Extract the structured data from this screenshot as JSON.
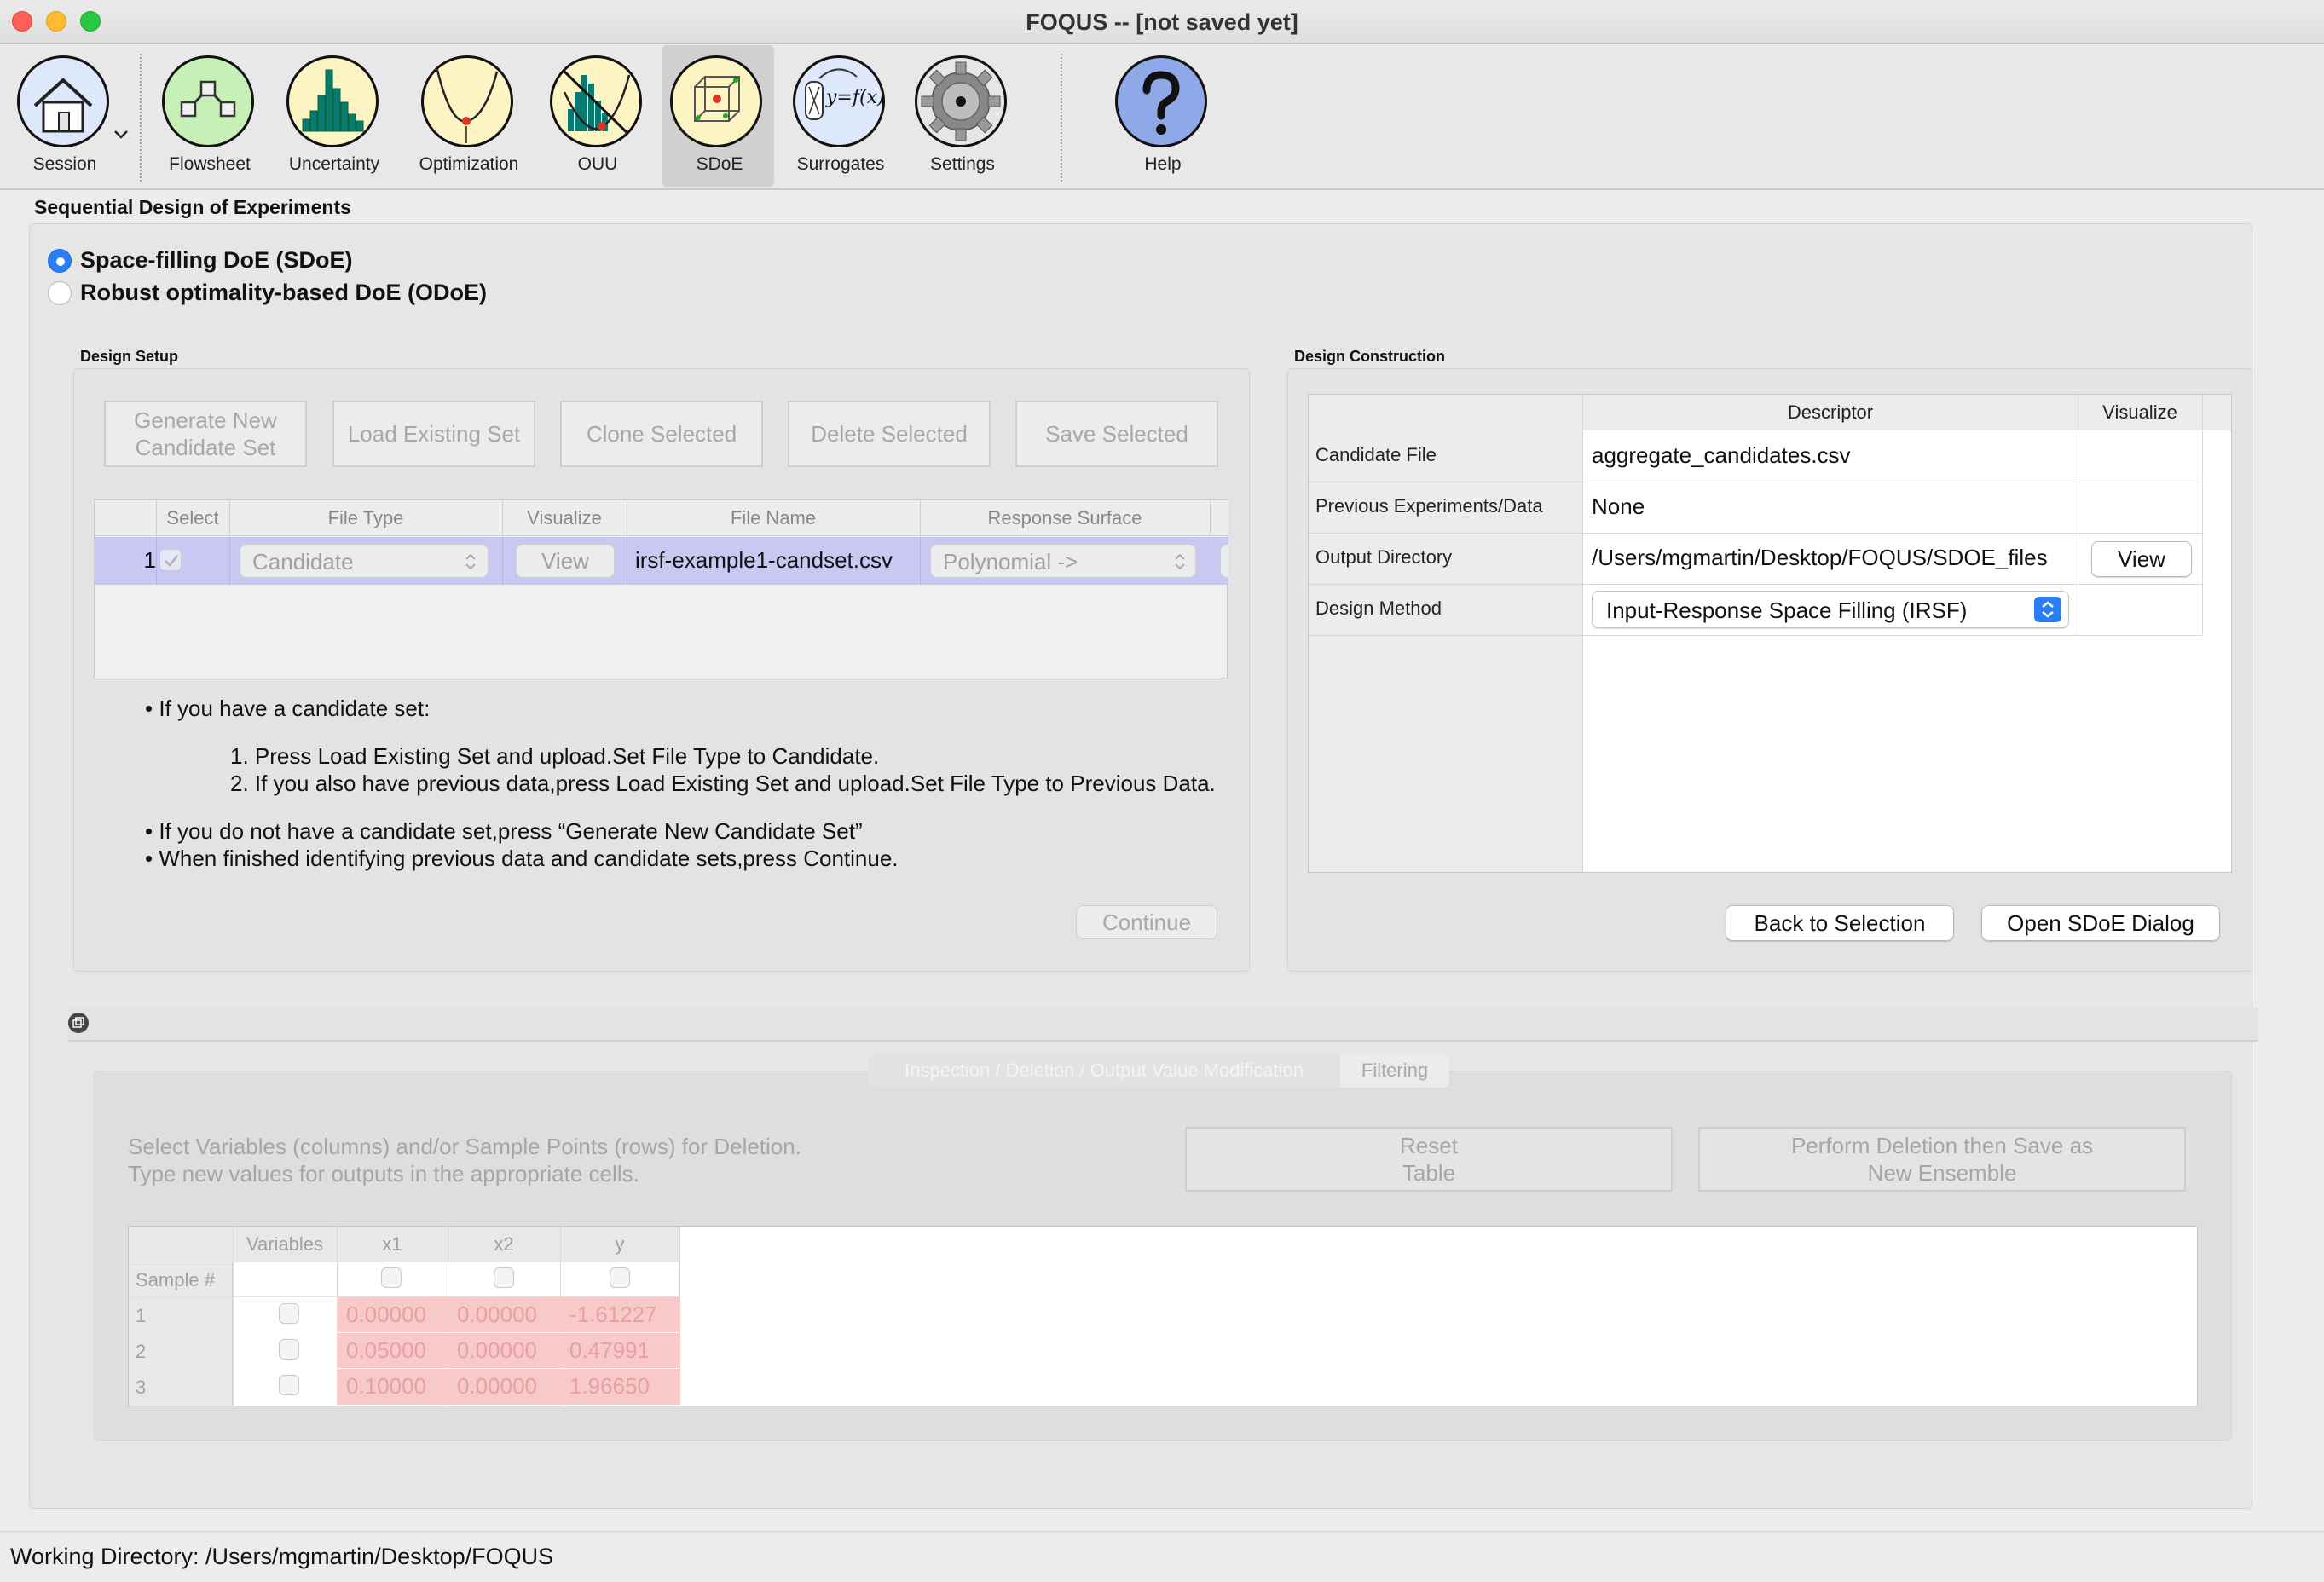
{
  "window": {
    "title": "FOQUS -- [not saved yet]"
  },
  "toolbar": {
    "items": [
      {
        "label": "Session"
      },
      {
        "label": "Flowsheet"
      },
      {
        "label": "Uncertainty"
      },
      {
        "label": "Optimization"
      },
      {
        "label": "OUU"
      },
      {
        "label": "SDoE"
      },
      {
        "label": "Surrogates"
      },
      {
        "label": "Settings"
      },
      {
        "label": "Help"
      }
    ],
    "active": "SDoE",
    "surrogate_glyph": "y=f(x)"
  },
  "page": {
    "title": "Sequential Design of Experiments",
    "radio_sdoe": "Space-filling DoE (SDoE)",
    "radio_odoe": "Robust optimality-based DoE (ODoE)",
    "selected": "sdoe"
  },
  "design_setup": {
    "title": "Design Setup",
    "buttons": {
      "generate": "Generate New Candidate Set",
      "load": "Load Existing Set",
      "clone": "Clone Selected",
      "delete": "Delete Selected",
      "save": "Save Selected"
    },
    "table": {
      "headers": {
        "select": "Select",
        "file_type": "File Type",
        "visualize": "Visualize",
        "file_name": "File Name",
        "response_surface": "Response Surface"
      },
      "rows": [
        {
          "num": "1",
          "selected": true,
          "file_type": "Candidate",
          "visualize": "View",
          "file_name": "irsf-example1-candset.csv",
          "response_surface": "Polynomial ->"
        }
      ]
    },
    "instructions": {
      "bullet1": "If you have a candidate set:",
      "step1": "1. Press Load Existing Set and upload.Set File Type to Candidate.",
      "step2": "2. If you also have previous data,press Load Existing Set and upload.Set File Type to Previous Data.",
      "bullet2": "If you do not have a candidate set,press “Generate New Candidate Set”",
      "bullet3": "When finished identifying previous data and candidate sets,press Continue."
    },
    "continue": "Continue"
  },
  "design_construction": {
    "title": "Design Construction",
    "headers": {
      "descriptor": "Descriptor",
      "visualize": "Visualize"
    },
    "rows": [
      {
        "label": "Candidate File",
        "value": "aggregate_candidates.csv"
      },
      {
        "label": "Previous Experiments/Data",
        "value": "None"
      },
      {
        "label": "Output Directory",
        "value": "/Users/mgmartin/Desktop/FOQUS/SDOE_files",
        "action": "View"
      },
      {
        "label": "Design Method",
        "value": "Input-Response Space Filling (IRSF)"
      }
    ],
    "back_button": "Back to Selection",
    "open_button": "Open SDoE Dialog"
  },
  "inspection": {
    "tabs": [
      "Inspection / Deletion / Output Value Modification",
      "Filtering"
    ],
    "help_line1": "Select Variables (columns) and/or Sample Points (rows) for Deletion.",
    "help_line2": "Type new values for outputs in the appropriate cells.",
    "reset_button": "Reset Table",
    "perform_button": "Perform Deletion then Save as New Ensemble",
    "table": {
      "corner": "",
      "headers": [
        "Variables",
        "x1",
        "x2",
        "y"
      ],
      "row_header": "Sample #",
      "rows": [
        {
          "id": "1",
          "x1": "0.00000",
          "x2": "0.00000",
          "y": "-1.61227"
        },
        {
          "id": "2",
          "x1": "0.05000",
          "x2": "0.00000",
          "y": "0.47991"
        },
        {
          "id": "3",
          "x1": "0.10000",
          "x2": "0.00000",
          "y": "1.96650"
        }
      ]
    }
  },
  "status_bar": {
    "text": "Working Directory: /Users/mgmartin/Desktop/FOQUS"
  },
  "colors": {
    "accent": "#2a7ef5",
    "selection": "#c8c8f2",
    "pink_cell": "#f7c9c9",
    "icon_yellow": "#fdf4c4",
    "icon_green": "#c7f0b6",
    "help_blue": "#8fa8e8"
  }
}
